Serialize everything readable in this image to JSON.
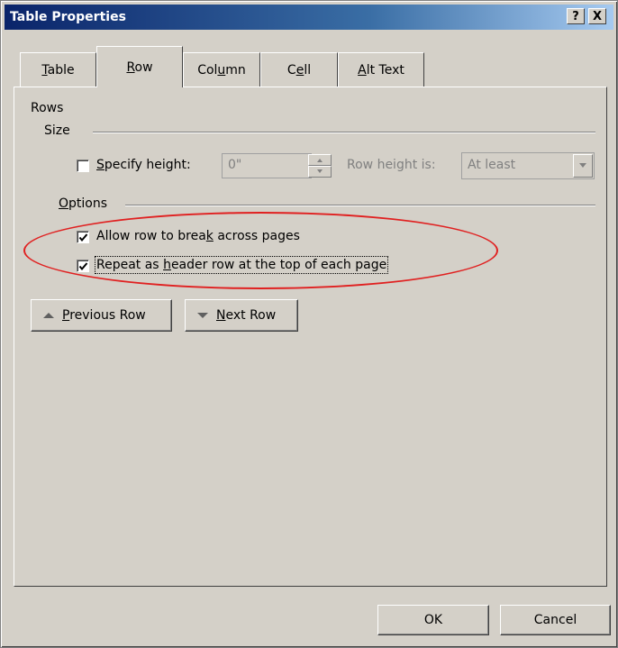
{
  "window": {
    "title": "Table Properties",
    "help_label": "?",
    "close_label": "X"
  },
  "tabs": [
    {
      "label": "Table",
      "accel": "T",
      "active": false
    },
    {
      "label": "Row",
      "accel": "R",
      "active": true
    },
    {
      "label": "Column",
      "accel": "u",
      "active": false
    },
    {
      "label": "Cell",
      "accel": "e",
      "active": false
    },
    {
      "label": "Alt Text",
      "accel": "A",
      "active": false
    }
  ],
  "rows_section": {
    "title": "Rows",
    "size_group": {
      "title": "Size",
      "specify_height": {
        "label": "Specify height:",
        "checked": false
      },
      "height_value": "0\"",
      "row_height_label": "Row height is:",
      "row_height_selected": "At least"
    },
    "options_group": {
      "title": "Options",
      "allow_break": {
        "label": "Allow row to break across pages",
        "checked": true
      },
      "repeat_header": {
        "label": "Repeat as header row at the top of each page",
        "checked": true
      }
    }
  },
  "nav_buttons": {
    "previous": "Previous Row",
    "next": "Next Row"
  },
  "footer": {
    "ok": "OK",
    "cancel": "Cancel"
  },
  "annotation": {
    "color": "#e02020"
  }
}
